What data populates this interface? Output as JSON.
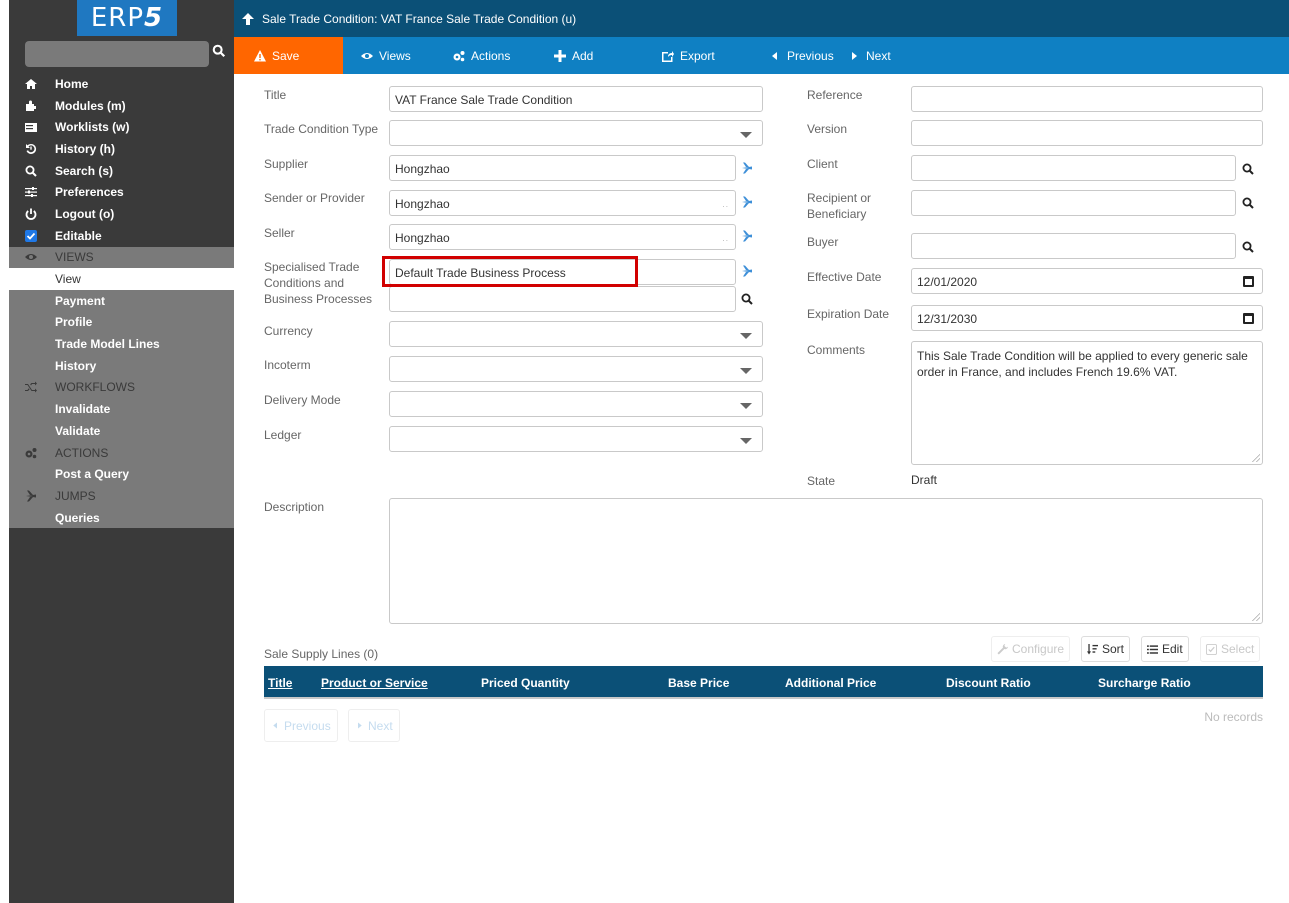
{
  "app": {
    "logo_text": "ERP",
    "logo_digit": "5",
    "search_placeholder": ""
  },
  "colors": {
    "header_dark": "#0b5077",
    "toolbar_blue": "#0f80c3",
    "save_orange": "#ff6600",
    "sidebar_bg": "#3a3a3a",
    "sidebar_section": "#7a7a7a",
    "highlight_red": "#d10000"
  },
  "sidebar": {
    "items": [
      {
        "label": "Home",
        "icon": "home-icon"
      },
      {
        "label": "Modules (m)",
        "icon": "puzzle-icon"
      },
      {
        "label": "Worklists (w)",
        "icon": "list-icon"
      },
      {
        "label": "History (h)",
        "icon": "history-icon"
      },
      {
        "label": "Search (s)",
        "icon": "search-icon"
      },
      {
        "label": "Preferences",
        "icon": "sliders-icon"
      },
      {
        "label": "Logout (o)",
        "icon": "power-icon"
      },
      {
        "label": "Editable",
        "icon": "checkbox-icon",
        "checked": true
      }
    ],
    "sections": {
      "views": {
        "label": "VIEWS",
        "items": [
          "View",
          "Payment",
          "Profile",
          "Trade Model Lines",
          "History"
        ],
        "active": "View"
      },
      "workflows": {
        "label": "WORKFLOWS",
        "items": [
          "Invalidate",
          "Validate"
        ]
      },
      "actions": {
        "label": "ACTIONS",
        "items": [
          "Post a Query"
        ]
      },
      "jumps": {
        "label": "JUMPS",
        "items": [
          "Queries"
        ]
      }
    }
  },
  "header": {
    "title": "Sale Trade Condition: VAT France Sale Trade Condition (u)"
  },
  "toolbar": {
    "save": "Save",
    "views": "Views",
    "actions": "Actions",
    "add": "Add",
    "export": "Export",
    "previous": "Previous",
    "next": "Next"
  },
  "form": {
    "left": {
      "title": {
        "label": "Title",
        "value": "VAT France Sale Trade Condition"
      },
      "trade_condition_type": {
        "label": "Trade Condition Type",
        "value": ""
      },
      "supplier": {
        "label": "Supplier",
        "value": "Hongzhao"
      },
      "sender": {
        "label": "Sender or Provider",
        "value": "Hongzhao"
      },
      "seller": {
        "label": "Seller",
        "value": "Hongzhao"
      },
      "specialised": {
        "label_1": "Specialised Trade",
        "label_2": "Conditions and",
        "label_3": "Business Processes",
        "value": "Default Trade Business Process",
        "value_2": ""
      },
      "currency": {
        "label": "Currency",
        "value": ""
      },
      "incoterm": {
        "label": "Incoterm",
        "value": ""
      },
      "delivery_mode": {
        "label": "Delivery Mode",
        "value": ""
      },
      "ledger": {
        "label": "Ledger",
        "value": ""
      }
    },
    "right": {
      "reference": {
        "label": "Reference",
        "value": ""
      },
      "version": {
        "label": "Version",
        "value": ""
      },
      "client": {
        "label": "Client",
        "value": ""
      },
      "recipient": {
        "label_1": "Recipient or",
        "label_2": "Beneficiary",
        "value": ""
      },
      "buyer": {
        "label": "Buyer",
        "value": ""
      },
      "effective_date": {
        "label": "Effective Date",
        "value": "12/01/2020"
      },
      "expiration_date": {
        "label": "Expiration Date",
        "value": "12/31/2030"
      },
      "comments": {
        "label": "Comments",
        "value": "This Sale Trade Condition will be applied to every generic sale order in France, and includes French 19.6% VAT."
      },
      "state": {
        "label": "State",
        "value": "Draft"
      }
    },
    "description": {
      "label": "Description",
      "value": ""
    }
  },
  "listbox": {
    "title": "Sale Supply Lines (0)",
    "buttons": {
      "configure": "Configure",
      "sort": "Sort",
      "edit": "Edit",
      "select": "Select"
    },
    "columns": [
      "Title",
      "Product or Service",
      "Priced Quantity",
      "Base Price",
      "Additional Price",
      "Discount Ratio",
      "Surcharge Ratio"
    ],
    "empty_text": "No records",
    "pagination": {
      "previous": "Previous",
      "next": "Next"
    }
  }
}
